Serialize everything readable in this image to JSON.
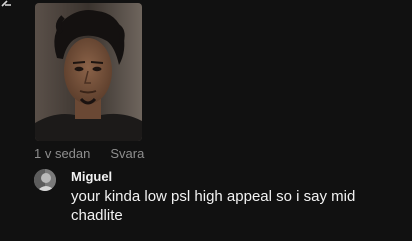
{
  "post": {
    "photo_alt": "Profile photo",
    "timestamp": "1 v sedan",
    "reply_label": "Svara"
  },
  "reply": {
    "author": "Miguel",
    "text": "your kinda low psl high appeal so i say mid chadlite"
  },
  "colors": {
    "background": "#111111",
    "meta_text": "#8e8e8e",
    "primary_text": "#f2f2f2"
  }
}
